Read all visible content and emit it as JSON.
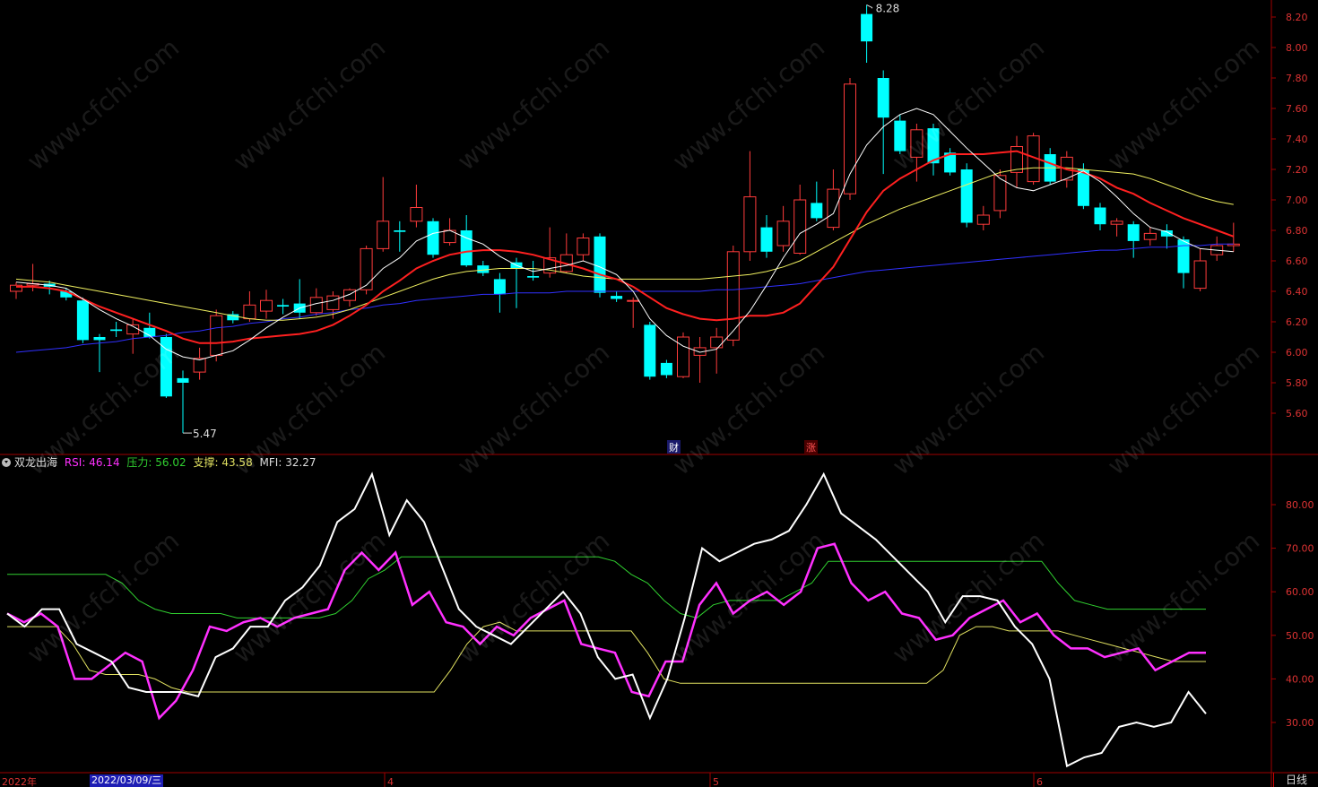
{
  "indicator": {
    "name": "双龙出海",
    "rsi_label": "RSI:",
    "rsi_value": "46.14",
    "pressure_label": "压力:",
    "pressure_value": "56.02",
    "support_label": "支撑:",
    "support_value": "43.58",
    "mfi_label": "MFI:",
    "mfi_value": "32.27"
  },
  "price_axis": {
    "ticks": [
      "8.20",
      "8.00",
      "7.80",
      "7.60",
      "7.40",
      "7.20",
      "7.00",
      "6.80",
      "6.60",
      "6.40",
      "6.20",
      "6.00",
      "5.80",
      "5.60"
    ],
    "high_label": "8.28",
    "low_label": "5.47"
  },
  "indicator_axis": {
    "ticks": [
      "80.00",
      "70.00",
      "60.00",
      "50.00",
      "40.00",
      "30.00"
    ]
  },
  "markers": {
    "cai": "财",
    "zhang": "涨"
  },
  "time_axis": {
    "year": "2022年",
    "crosshair_date": "2022/03/09/三",
    "months": [
      "4",
      "5",
      "6"
    ]
  },
  "period": "日线",
  "watermark": "www.cfchi.com",
  "colors": {
    "up": "#ff3b3b",
    "down": "#00ffff",
    "ma5": "#ffffff",
    "ma10": "#ff2020",
    "ma20": "#f0f060",
    "ma60": "#3030ff",
    "rsi": "#ff30ff",
    "pressure": "#30d030",
    "support": "#e0e060",
    "mfi": "#ffffff"
  },
  "chart_data": {
    "type": "candlestick",
    "candles": [
      {
        "o": 6.4,
        "c": 6.44,
        "h": 6.46,
        "l": 6.35
      },
      {
        "o": 6.44,
        "c": 6.45,
        "h": 6.58,
        "l": 6.4
      },
      {
        "o": 6.45,
        "c": 6.43,
        "h": 6.47,
        "l": 6.38
      },
      {
        "o": 6.4,
        "c": 6.36,
        "h": 6.42,
        "l": 6.34
      },
      {
        "o": 6.34,
        "c": 6.08,
        "h": 6.36,
        "l": 6.06
      },
      {
        "o": 6.1,
        "c": 6.08,
        "h": 6.12,
        "l": 5.87
      },
      {
        "o": 6.15,
        "c": 6.14,
        "h": 6.2,
        "l": 6.1
      },
      {
        "o": 6.12,
        "c": 6.18,
        "h": 6.22,
        "l": 5.99
      },
      {
        "o": 6.16,
        "c": 6.1,
        "h": 6.26,
        "l": 6.09
      },
      {
        "o": 6.1,
        "c": 5.71,
        "h": 6.12,
        "l": 5.7
      },
      {
        "o": 5.83,
        "c": 5.8,
        "h": 5.88,
        "l": 5.47
      },
      {
        "o": 5.87,
        "c": 5.96,
        "h": 6.03,
        "l": 5.82
      },
      {
        "o": 5.98,
        "c": 6.24,
        "h": 6.28,
        "l": 5.94
      },
      {
        "o": 6.25,
        "c": 6.21,
        "h": 6.27,
        "l": 6.19
      },
      {
        "o": 6.22,
        "c": 6.31,
        "h": 6.4,
        "l": 6.2
      },
      {
        "o": 6.27,
        "c": 6.34,
        "h": 6.41,
        "l": 6.22
      },
      {
        "o": 6.31,
        "c": 6.3,
        "h": 6.35,
        "l": 6.25
      },
      {
        "o": 6.32,
        "c": 6.26,
        "h": 6.48,
        "l": 6.22
      },
      {
        "o": 6.26,
        "c": 6.36,
        "h": 6.42,
        "l": 6.24
      },
      {
        "o": 6.28,
        "c": 6.37,
        "h": 6.4,
        "l": 6.22
      },
      {
        "o": 6.34,
        "c": 6.41,
        "h": 6.42,
        "l": 6.3
      },
      {
        "o": 6.41,
        "c": 6.68,
        "h": 6.7,
        "l": 6.38
      },
      {
        "o": 6.68,
        "c": 6.86,
        "h": 7.15,
        "l": 6.66
      },
      {
        "o": 6.8,
        "c": 6.79,
        "h": 6.86,
        "l": 6.66
      },
      {
        "o": 6.86,
        "c": 6.95,
        "h": 7.1,
        "l": 6.82
      },
      {
        "o": 6.86,
        "c": 6.64,
        "h": 6.88,
        "l": 6.62
      },
      {
        "o": 6.72,
        "c": 6.8,
        "h": 6.88,
        "l": 6.7
      },
      {
        "o": 6.8,
        "c": 6.57,
        "h": 6.9,
        "l": 6.56
      },
      {
        "o": 6.57,
        "c": 6.52,
        "h": 6.6,
        "l": 6.5
      },
      {
        "o": 6.48,
        "c": 6.38,
        "h": 6.52,
        "l": 6.26
      },
      {
        "o": 6.59,
        "c": 6.55,
        "h": 6.62,
        "l": 6.29
      },
      {
        "o": 6.5,
        "c": 6.49,
        "h": 6.6,
        "l": 6.47
      },
      {
        "o": 6.52,
        "c": 6.62,
        "h": 6.82,
        "l": 6.49
      },
      {
        "o": 6.53,
        "c": 6.64,
        "h": 6.78,
        "l": 6.52
      },
      {
        "o": 6.64,
        "c": 6.75,
        "h": 6.78,
        "l": 6.6
      },
      {
        "o": 6.76,
        "c": 6.39,
        "h": 6.78,
        "l": 6.36
      },
      {
        "o": 6.37,
        "c": 6.35,
        "h": 6.4,
        "l": 6.33
      },
      {
        "o": 6.34,
        "c": 6.34,
        "h": 6.36,
        "l": 6.16
      },
      {
        "o": 6.18,
        "c": 5.84,
        "h": 6.2,
        "l": 5.82
      },
      {
        "o": 5.93,
        "c": 5.85,
        "h": 5.95,
        "l": 5.83
      },
      {
        "o": 5.84,
        "c": 6.1,
        "h": 6.13,
        "l": 5.83
      },
      {
        "o": 5.98,
        "c": 6.03,
        "h": 6.1,
        "l": 5.8
      },
      {
        "o": 6.03,
        "c": 6.1,
        "h": 6.16,
        "l": 5.86
      },
      {
        "o": 6.08,
        "c": 6.66,
        "h": 6.7,
        "l": 6.04
      },
      {
        "o": 6.66,
        "c": 7.02,
        "h": 7.32,
        "l": 6.6
      },
      {
        "o": 6.82,
        "c": 6.66,
        "h": 6.9,
        "l": 6.62
      },
      {
        "o": 6.7,
        "c": 6.86,
        "h": 6.96,
        "l": 6.66
      },
      {
        "o": 6.65,
        "c": 7.0,
        "h": 7.1,
        "l": 6.64
      },
      {
        "o": 6.98,
        "c": 6.88,
        "h": 7.12,
        "l": 6.86
      },
      {
        "o": 6.82,
        "c": 7.07,
        "h": 7.2,
        "l": 6.8
      },
      {
        "o": 7.04,
        "c": 7.76,
        "h": 7.8,
        "l": 7.0
      },
      {
        "o": 8.22,
        "c": 8.04,
        "h": 8.28,
        "l": 7.9
      },
      {
        "o": 7.8,
        "c": 7.54,
        "h": 7.85,
        "l": 7.17
      },
      {
        "o": 7.52,
        "c": 7.32,
        "h": 7.56,
        "l": 7.3
      },
      {
        "o": 7.28,
        "c": 7.46,
        "h": 7.5,
        "l": 7.12
      },
      {
        "o": 7.47,
        "c": 7.24,
        "h": 7.5,
        "l": 7.16
      },
      {
        "o": 7.31,
        "c": 7.18,
        "h": 7.34,
        "l": 7.16
      },
      {
        "o": 7.2,
        "c": 6.85,
        "h": 7.24,
        "l": 6.82
      },
      {
        "o": 6.84,
        "c": 6.9,
        "h": 6.96,
        "l": 6.8
      },
      {
        "o": 6.93,
        "c": 7.16,
        "h": 7.2,
        "l": 6.88
      },
      {
        "o": 7.18,
        "c": 7.35,
        "h": 7.42,
        "l": 7.08
      },
      {
        "o": 7.12,
        "c": 7.42,
        "h": 7.44,
        "l": 7.1
      },
      {
        "o": 7.3,
        "c": 7.12,
        "h": 7.34,
        "l": 7.1
      },
      {
        "o": 7.13,
        "c": 7.28,
        "h": 7.32,
        "l": 7.08
      },
      {
        "o": 7.2,
        "c": 6.96,
        "h": 7.24,
        "l": 6.94
      },
      {
        "o": 6.95,
        "c": 6.84,
        "h": 6.98,
        "l": 6.8
      },
      {
        "o": 6.84,
        "c": 6.86,
        "h": 6.88,
        "l": 6.76
      },
      {
        "o": 6.84,
        "c": 6.73,
        "h": 6.86,
        "l": 6.62
      },
      {
        "o": 6.74,
        "c": 6.78,
        "h": 6.82,
        "l": 6.7
      },
      {
        "o": 6.8,
        "c": 6.76,
        "h": 6.84,
        "l": 6.68
      },
      {
        "o": 6.74,
        "c": 6.52,
        "h": 6.76,
        "l": 6.42
      },
      {
        "o": 6.42,
        "c": 6.6,
        "h": 6.68,
        "l": 6.4
      },
      {
        "o": 6.64,
        "c": 6.7,
        "h": 6.76,
        "l": 6.6
      },
      {
        "o": 6.7,
        "c": 6.71,
        "h": 6.85,
        "l": 6.66
      }
    ],
    "ma5": [
      6.46,
      6.45,
      6.44,
      6.42,
      6.35,
      6.28,
      6.22,
      6.17,
      6.11,
      6.02,
      5.97,
      5.95,
      5.98,
      6.01,
      6.08,
      6.16,
      6.23,
      6.29,
      6.32,
      6.34,
      6.38,
      6.44,
      6.55,
      6.62,
      6.73,
      6.78,
      6.8,
      6.75,
      6.71,
      6.63,
      6.57,
      6.53,
      6.55,
      6.57,
      6.6,
      6.56,
      6.51,
      6.4,
      6.22,
      6.11,
      6.04,
      6.0,
      6.02,
      6.14,
      6.27,
      6.44,
      6.62,
      6.78,
      6.84,
      6.91,
      7.17,
      7.36,
      7.48,
      7.56,
      7.6,
      7.56,
      7.45,
      7.34,
      7.24,
      7.14,
      7.08,
      7.06,
      7.1,
      7.14,
      7.19,
      7.12,
      7.02,
      6.91,
      6.82,
      6.79,
      6.73,
      6.68,
      6.67,
      6.66
    ],
    "ma10": [
      6.43,
      6.43,
      6.42,
      6.4,
      6.35,
      6.3,
      6.26,
      6.22,
      6.18,
      6.14,
      6.09,
      6.06,
      6.06,
      6.07,
      6.09,
      6.1,
      6.11,
      6.12,
      6.14,
      6.18,
      6.24,
      6.31,
      6.4,
      6.47,
      6.55,
      6.6,
      6.64,
      6.66,
      6.67,
      6.67,
      6.66,
      6.64,
      6.61,
      6.58,
      6.55,
      6.51,
      6.48,
      6.43,
      6.36,
      6.29,
      6.25,
      6.22,
      6.21,
      6.22,
      6.24,
      6.24,
      6.26,
      6.32,
      6.44,
      6.56,
      6.74,
      6.92,
      7.06,
      7.14,
      7.2,
      7.26,
      7.3,
      7.3,
      7.3,
      7.31,
      7.32,
      7.28,
      7.24,
      7.2,
      7.18,
      7.14,
      7.08,
      7.04,
      6.98,
      6.93,
      6.88,
      6.84,
      6.8,
      6.76
    ],
    "ma20": [
      6.48,
      6.47,
      6.46,
      6.44,
      6.42,
      6.4,
      6.38,
      6.36,
      6.34,
      6.32,
      6.3,
      6.28,
      6.26,
      6.24,
      6.22,
      6.21,
      6.21,
      6.22,
      6.23,
      6.25,
      6.28,
      6.32,
      6.36,
      6.4,
      6.44,
      6.48,
      6.51,
      6.53,
      6.54,
      6.55,
      6.55,
      6.55,
      6.54,
      6.52,
      6.5,
      6.49,
      6.48,
      6.48,
      6.48,
      6.48,
      6.48,
      6.48,
      6.49,
      6.5,
      6.51,
      6.53,
      6.56,
      6.6,
      6.66,
      6.72,
      6.78,
      6.84,
      6.89,
      6.94,
      6.98,
      7.02,
      7.06,
      7.1,
      7.14,
      7.18,
      7.2,
      7.21,
      7.21,
      7.21,
      7.2,
      7.19,
      7.18,
      7.17,
      7.14,
      7.1,
      7.06,
      7.02,
      6.99,
      6.97
    ],
    "ma60": [
      6.0,
      6.01,
      6.02,
      6.03,
      6.05,
      6.06,
      6.07,
      6.09,
      6.1,
      6.11,
      6.13,
      6.14,
      6.16,
      6.17,
      6.19,
      6.2,
      6.22,
      6.23,
      6.25,
      6.26,
      6.28,
      6.29,
      6.31,
      6.32,
      6.34,
      6.35,
      6.36,
      6.37,
      6.38,
      6.38,
      6.39,
      6.39,
      6.39,
      6.4,
      6.4,
      6.4,
      6.4,
      6.4,
      6.4,
      6.4,
      6.4,
      6.4,
      6.41,
      6.41,
      6.42,
      6.43,
      6.44,
      6.45,
      6.47,
      6.49,
      6.51,
      6.53,
      6.54,
      6.55,
      6.56,
      6.57,
      6.58,
      6.59,
      6.6,
      6.61,
      6.62,
      6.63,
      6.64,
      6.65,
      6.66,
      6.67,
      6.67,
      6.68,
      6.69,
      6.69,
      6.7,
      6.7,
      6.71,
      6.71
    ],
    "rsi": [
      55,
      53,
      55,
      52,
      40,
      40,
      43,
      46,
      44,
      31,
      35,
      42,
      52,
      51,
      53,
      54,
      52,
      54,
      55,
      56,
      65,
      69,
      65,
      69,
      57,
      60,
      53,
      52,
      48,
      52,
      50,
      54,
      56,
      58,
      48,
      47,
      46,
      37,
      36,
      44,
      44,
      57,
      62,
      55,
      58,
      60,
      57,
      60,
      70,
      71,
      62,
      58,
      60,
      55,
      54,
      49,
      50,
      54,
      56,
      58,
      53,
      55,
      50,
      47,
      47,
      45,
      46,
      47,
      42,
      44,
      46,
      46
    ],
    "pressure": [
      64,
      64,
      64,
      64,
      64,
      64,
      64,
      62,
      58,
      56,
      55,
      55,
      55,
      55,
      54,
      54,
      54,
      54,
      54,
      54,
      55,
      58,
      63,
      65,
      68,
      68,
      68,
      68,
      68,
      68,
      68,
      68,
      68,
      68,
      68,
      68,
      68,
      67,
      64,
      62,
      58,
      55,
      54,
      57,
      58,
      58,
      58,
      58,
      60,
      62,
      67,
      67,
      67,
      67,
      67,
      67,
      67,
      67,
      67,
      67,
      67,
      67,
      67,
      67,
      62,
      58,
      57,
      56,
      56,
      56,
      56,
      56,
      56,
      56
    ],
    "support": [
      52,
      52,
      52,
      52,
      48,
      42,
      41,
      41,
      41,
      40,
      38,
      37,
      37,
      37,
      37,
      37,
      37,
      37,
      37,
      37,
      37,
      37,
      37,
      37,
      37,
      37,
      37,
      42,
      48,
      52,
      53,
      51,
      51,
      51,
      51,
      51,
      51,
      51,
      51,
      46,
      40,
      39,
      39,
      39,
      39,
      39,
      39,
      39,
      39,
      39,
      39,
      39,
      39,
      39,
      39,
      39,
      39,
      42,
      50,
      52,
      52,
      51,
      51,
      51,
      51,
      50,
      49,
      48,
      47,
      46,
      45,
      44,
      44,
      44
    ],
    "mfi": [
      55,
      52,
      56,
      56,
      48,
      46,
      44,
      38,
      37,
      37,
      37,
      36,
      45,
      47,
      52,
      52,
      58,
      61,
      66,
      76,
      79,
      87,
      73,
      81,
      76,
      66,
      56,
      52,
      50,
      48,
      52,
      56,
      60,
      55,
      45,
      40,
      41,
      31,
      40,
      54,
      70,
      67,
      69,
      71,
      72,
      74,
      80,
      87,
      78,
      75,
      72,
      68,
      64,
      60,
      53,
      59,
      59,
      58,
      52,
      48,
      40,
      20,
      22,
      23,
      29,
      30,
      29,
      30,
      37,
      32
    ]
  }
}
